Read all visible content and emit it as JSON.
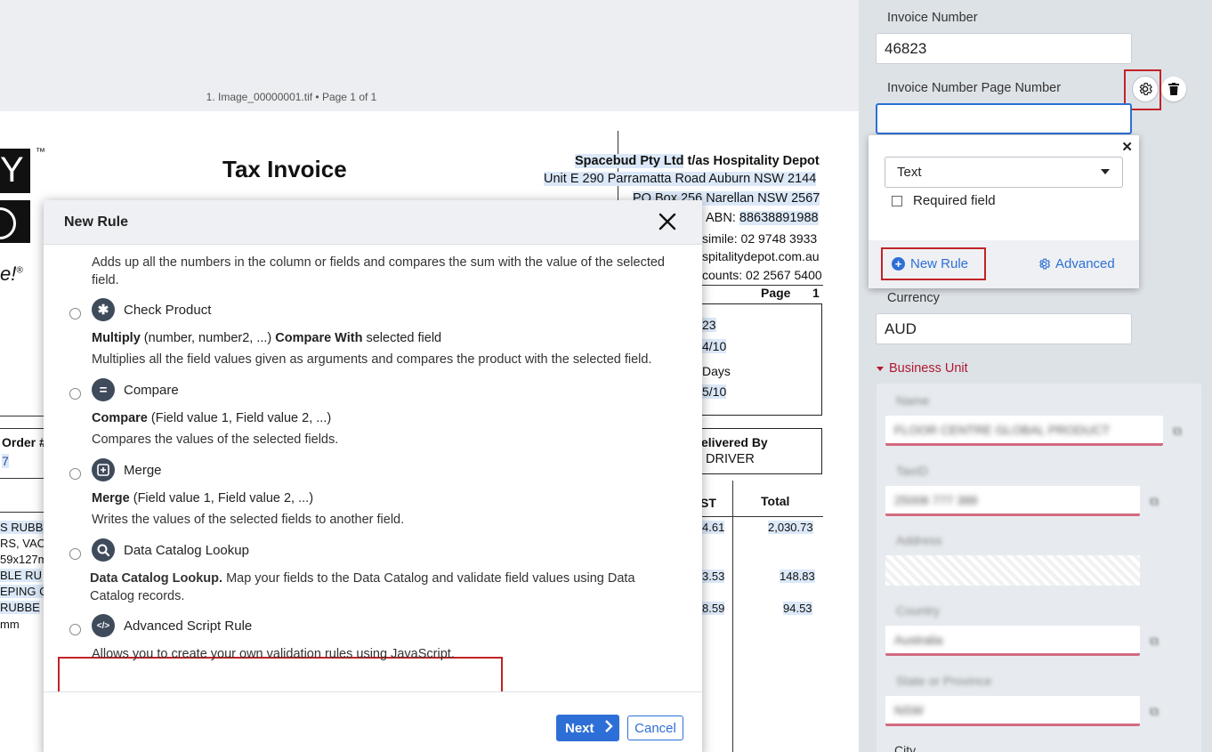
{
  "viewer": {
    "caption": "1. Image_00000001.tif • Page 1 of 1",
    "doc": {
      "logo_tm": "™",
      "logo_letter_1": "Y",
      "logo_tagline": "e!",
      "logo_reg": "®",
      "title": "Tax Invoice",
      "supplier_name": "Spacebud Pty Ltd",
      "supplier_suffix": " t/as Hospitality Depot",
      "address_1": "Unit E 290 Parramatta Road Auburn NSW 2144",
      "address_2": "PO Box 256 Narellan NSW 2567",
      "abn_label": "ABN: ",
      "abn_value": "88638891988",
      "facsimile": "simile: 02 9748 3933",
      "web": "spitalitydepot.com.au",
      "accounts": "counts: 02 2567 5400",
      "page_label": "Page",
      "page_value": "1",
      "ref_1": "23",
      "ref_2": "4/10",
      "ref_3": "Days",
      "ref_4": "5/10",
      "delivered_by_label": "elivered By",
      "delivered_by_value": "DRIVER",
      "order_label": "Order #",
      "order_value": "7",
      "col_gst": "ST",
      "col_total": "Total",
      "rows": [
        {
          "desc": "S RUBBE",
          "gst": "4.61",
          "total": "2,030.73"
        },
        {
          "desc": "RS, VAC",
          "gst": "",
          "total": ""
        },
        {
          "desc": "59x127m",
          "gst": "",
          "total": ""
        },
        {
          "desc": "BLE RU",
          "gst": "3.53",
          "total": "148.83"
        },
        {
          "desc": "EPING C",
          "gst": "",
          "total": ""
        },
        {
          "desc": "RUBBE",
          "gst": "8.59",
          "total": "94.53"
        },
        {
          "desc": "mm",
          "gst": "",
          "total": ""
        }
      ]
    }
  },
  "modal": {
    "title": "New Rule",
    "partial_desc": "Adds up all the numbers in the column or fields and compares the sum with the value of the selected field.",
    "rules": [
      {
        "name": "Check Product",
        "icon": "asterisk-icon",
        "glyph": "✱",
        "syntax_bold": "Multiply",
        "syntax_rest": " (number, number2, ...) ",
        "syntax_bold2": "Compare With",
        "syntax_rest2": " selected field",
        "desc": "Multiplies all the field values given as arguments and compares the product with the selected field."
      },
      {
        "name": "Compare",
        "icon": "equals-icon",
        "glyph": "=",
        "syntax_bold": "Compare",
        "syntax_rest": " (Field value 1, Field value 2, ...)",
        "desc": "Compares the values of the selected fields."
      },
      {
        "name": "Merge",
        "icon": "merge-icon",
        "glyph": "⊞",
        "syntax_bold": "Merge",
        "syntax_rest": " (Field value 1, Field value 2, ...)",
        "desc": "Writes the values of the selected fields to another field."
      },
      {
        "name": "Data Catalog Lookup",
        "icon": "search-icon",
        "glyph": "⌕",
        "syntax_bold": "Data Catalog Lookup.",
        "desc": "  Map your fields to the Data Catalog and validate field values using Data Catalog records."
      },
      {
        "name": "Advanced Script Rule",
        "icon": "code-icon",
        "glyph": "</>",
        "desc": "Allows you to create your own validation rules using JavaScript."
      }
    ],
    "next_label": "Next",
    "cancel_label": "Cancel"
  },
  "panel": {
    "invoice_number_label": "Invoice Number",
    "invoice_number_value": "46823",
    "page_number_label": "Invoice Number Page Number",
    "page_number_value": "",
    "currency_label": "Currency",
    "currency_value": "AUD",
    "business_unit_label": "Business Unit",
    "business_unit_fields": [
      {
        "label": "Name",
        "value": "FLOOR CENTRE GLOBAL PRODUCT"
      },
      {
        "label": "TaxID",
        "value": "25006 777 388"
      },
      {
        "label": "Address",
        "value": ""
      },
      {
        "label": "Country",
        "value": "Australia"
      },
      {
        "label": "State or Province",
        "value": "NSW"
      }
    ],
    "city_label": "City"
  },
  "popover": {
    "type_value": "Text",
    "required_label": "Required field",
    "new_rule_label": "New Rule",
    "advanced_label": "Advanced"
  },
  "colors": {
    "accent": "#2d6fd6",
    "highlight_red": "#c12328",
    "section_red": "#b0182f"
  }
}
